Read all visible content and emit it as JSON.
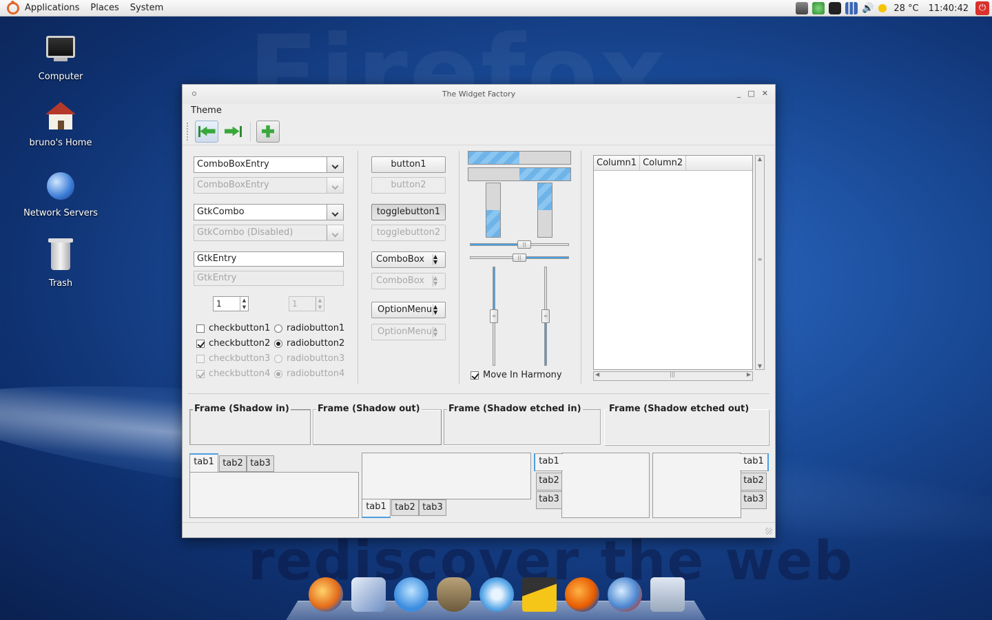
{
  "panel": {
    "menus": [
      "Applications",
      "Places",
      "System"
    ],
    "temperature": "28 °C",
    "clock": "11:40:42"
  },
  "desktop_icons": [
    {
      "label": "Computer",
      "icon": "computer-icon"
    },
    {
      "label": "bruno's Home",
      "icon": "home-folder-icon"
    },
    {
      "label": "Network Servers",
      "icon": "network-icon"
    },
    {
      "label": "Trash",
      "icon": "trash-icon"
    }
  ],
  "window": {
    "title": "The Widget Factory",
    "menu": [
      "Theme"
    ],
    "toolbar": [
      "go-first-icon",
      "go-last-icon",
      "add-icon"
    ]
  },
  "column1": {
    "combo_entry": "ComboBoxEntry",
    "combo_entry_disabled": "ComboBoxEntry",
    "gtk_combo": "GtkCombo",
    "gtk_combo_disabled": "GtkCombo (Disabled)",
    "entry": "GtkEntry",
    "entry_disabled": "GtkEntry",
    "spin": "1",
    "spin_disabled": "1",
    "checks": [
      {
        "label": "checkbutton1",
        "checked": false,
        "disabled": false
      },
      {
        "label": "checkbutton2",
        "checked": true,
        "disabled": false
      },
      {
        "label": "checkbutton3",
        "checked": false,
        "disabled": true
      },
      {
        "label": "checkbutton4",
        "checked": true,
        "disabled": true
      }
    ],
    "radios": [
      {
        "label": "radiobutton1",
        "checked": false,
        "disabled": false
      },
      {
        "label": "radiobutton2",
        "checked": true,
        "disabled": false
      },
      {
        "label": "radiobutton3",
        "checked": false,
        "disabled": true
      },
      {
        "label": "radiobutton4",
        "checked": true,
        "disabled": true
      }
    ]
  },
  "column2": {
    "button1": "button1",
    "button2": "button2",
    "toggle1": "togglebutton1",
    "toggle2": "togglebutton2",
    "combobox": "ComboBox",
    "combobox_disabled": "ComboBox",
    "optionmenu": "OptionMenu",
    "optionmenu_disabled": "OptionMenu"
  },
  "column3": {
    "move_in_harmony": "Move In Harmony",
    "progress_h1": 0.5,
    "progress_h2": 0.5,
    "hscale1": 0.55,
    "hscale2": 0.5,
    "vscale1": 0.5,
    "vscale2": 0.5
  },
  "tree": {
    "columns": [
      "Column1",
      "Column2"
    ]
  },
  "frames": [
    "Frame (Shadow in)",
    "Frame (Shadow out)",
    "Frame (Shadow etched in)",
    "Frame (Shadow etched out)"
  ],
  "notebooks": {
    "tabs": [
      "tab1",
      "tab2",
      "tab3"
    ]
  }
}
